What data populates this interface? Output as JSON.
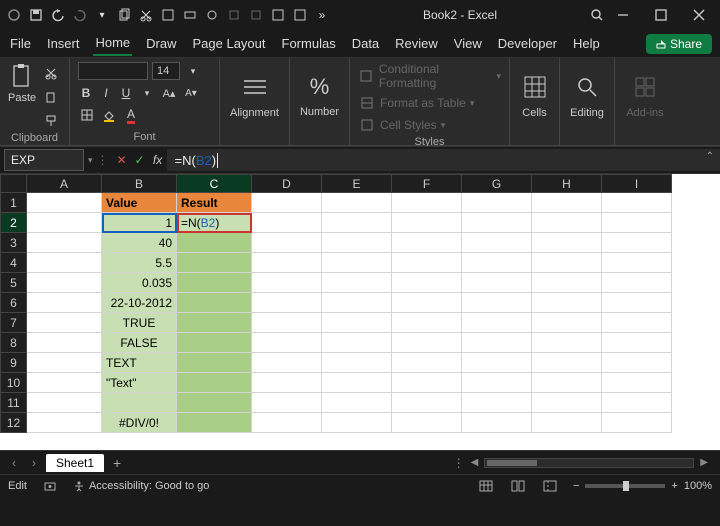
{
  "title": "Book2 - Excel",
  "menu": {
    "file": "File",
    "insert": "Insert",
    "home": "Home",
    "draw": "Draw",
    "pagelayout": "Page Layout",
    "formulas": "Formulas",
    "data": "Data",
    "review": "Review",
    "view": "View",
    "developer": "Developer",
    "help": "Help"
  },
  "share": "Share",
  "ribbon": {
    "clipboard": {
      "label": "Clipboard",
      "paste": "Paste"
    },
    "font": {
      "label": "Font",
      "name": "",
      "size": "14",
      "bold": "B",
      "italic": "I",
      "underline": "U"
    },
    "alignment": {
      "label": "Alignment"
    },
    "number": {
      "label": "Number",
      "percent": "%"
    },
    "styles": {
      "label": "Styles",
      "cond": "Conditional Formatting",
      "table": "Format as Table",
      "cell": "Cell Styles"
    },
    "cells": {
      "label": "Cells"
    },
    "editing": {
      "label": "Editing"
    },
    "addins": {
      "label": "Add-ins"
    }
  },
  "namebox": "EXP",
  "formula": "=N(B2)",
  "formula_prefix": "=N(",
  "formula_ref": "B2",
  "formula_suffix": ")",
  "cols": [
    "A",
    "B",
    "C",
    "D",
    "E",
    "F",
    "G",
    "H",
    "I"
  ],
  "headers": {
    "value": "Value",
    "result": "Result"
  },
  "values": {
    "b2": "1",
    "b3": "40",
    "b4": "5.5",
    "b5": "0.035",
    "b6": "22-10-2012",
    "b7": "TRUE",
    "b8": "FALSE",
    "b9": "TEXT",
    "b10": "\"Text\"",
    "b11": "",
    "b12": "#DIV/0!"
  },
  "cellformula": {
    "prefix": "=N(",
    "ref": "B2",
    "suffix": ")"
  },
  "sheet": {
    "name": "Sheet1"
  },
  "status": {
    "mode": "Edit",
    "access": "Accessibility: Good to go",
    "zoom": "100%"
  }
}
